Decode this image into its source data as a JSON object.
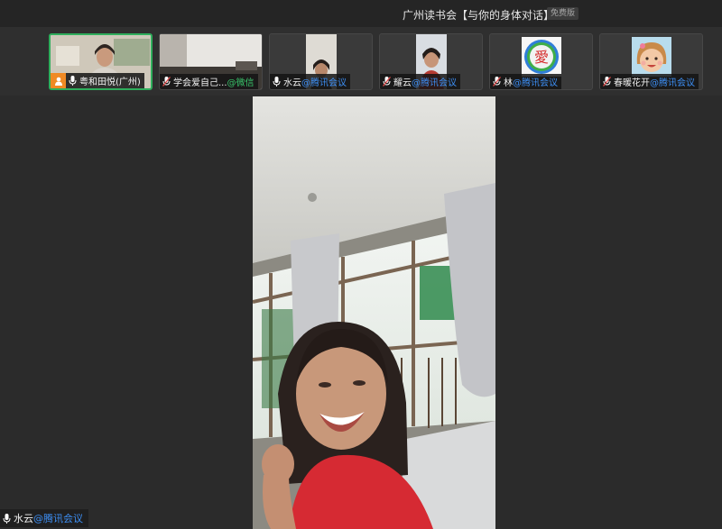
{
  "window": {
    "title": "广州读书会【与你的身体对话】",
    "edition_badge": "免费版"
  },
  "participants": [
    {
      "name": "粤和田悦(广州)",
      "suffix": "",
      "is_host": true,
      "active": true,
      "thumb": "video"
    },
    {
      "name": "学会爱自己...",
      "suffix": "@微信",
      "is_host": false,
      "active": false,
      "thumb": "video"
    },
    {
      "name": "水云",
      "suffix": "@腾讯会议",
      "is_host": false,
      "active": false,
      "thumb": "video"
    },
    {
      "name": "耀云",
      "suffix": "@腾讯会议",
      "is_host": false,
      "active": false,
      "thumb": "video"
    },
    {
      "name": "林",
      "suffix": "@腾讯会议",
      "is_host": false,
      "active": false,
      "thumb": "avatar",
      "avatar_text": "愛"
    },
    {
      "name": "春暖花开",
      "suffix": "@腾讯会议",
      "is_host": false,
      "active": false,
      "thumb": "avatar"
    }
  ],
  "main_video": {
    "speaker_name": "水云",
    "speaker_suffix": "@腾讯会议"
  },
  "colors": {
    "active_border": "#2fae5c",
    "host_badge": "#f08a24",
    "suffix_blue": "#3d8ff5",
    "suffix_green": "#39c56b"
  }
}
